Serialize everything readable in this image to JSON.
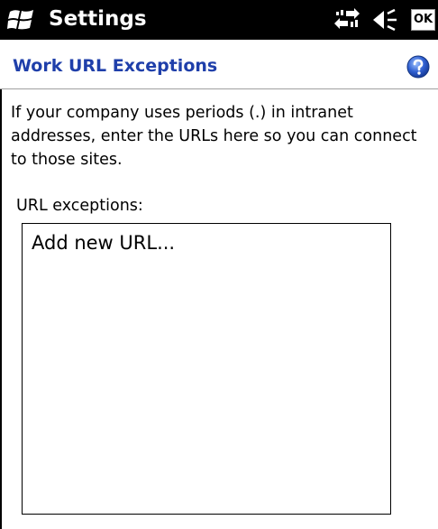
{
  "titlebar": {
    "app_title": "Settings",
    "ok_label": "OK",
    "start_icon": "windows-flag-icon",
    "status_icons": [
      "connectivity-icon",
      "volume-icon"
    ]
  },
  "header": {
    "title": "Work URL Exceptions",
    "help_icon": "help-icon"
  },
  "content": {
    "description": "If your company uses periods (.) in intranet addresses, enter the URLs here so you can connect to those sites.",
    "list_label": "URL exceptions:",
    "list_items": [
      "Add new URL..."
    ]
  },
  "colors": {
    "titlebar_bg": "#000000",
    "title_text": "#1f3faa",
    "help_icon": "#2f5fd0"
  }
}
